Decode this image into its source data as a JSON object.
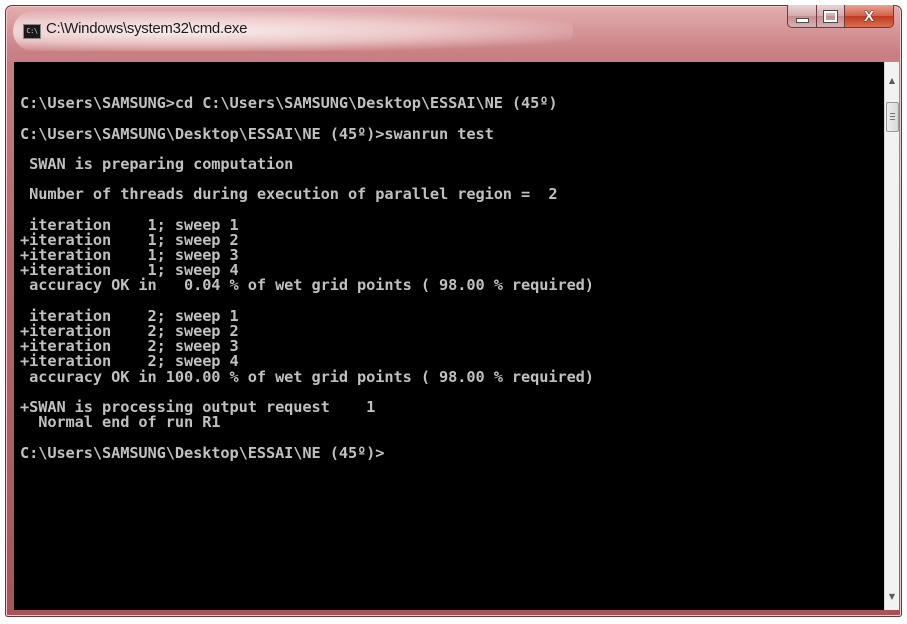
{
  "window": {
    "title": "C:\\Windows\\system32\\cmd.exe",
    "icon": "cmd-icon",
    "icon_text": "C:\\",
    "controls": {
      "minimize_icon": "minimize-icon",
      "maximize_icon": "maximize-icon",
      "close_icon": "close-icon",
      "close_glyph": "X"
    }
  },
  "console": {
    "lines": [
      "",
      "C:\\Users\\SAMSUNG>cd C:\\Users\\SAMSUNG\\Desktop\\ESSAI\\NE (45º)",
      "",
      "C:\\Users\\SAMSUNG\\Desktop\\ESSAI\\NE (45º)>swanrun test",
      "",
      " SWAN is preparing computation",
      "",
      " Number of threads during execution of parallel region =  2",
      "",
      " iteration    1; sweep 1",
      "+iteration    1; sweep 2",
      "+iteration    1; sweep 3",
      "+iteration    1; sweep 4",
      " accuracy OK in   0.04 % of wet grid points ( 98.00 % required)",
      "",
      " iteration    2; sweep 1",
      "+iteration    2; sweep 2",
      "+iteration    2; sweep 3",
      "+iteration    2; sweep 4",
      " accuracy OK in 100.00 % of wet grid points ( 98.00 % required)",
      "",
      "+SWAN is processing output request    1",
      "  Normal end of run R1",
      "",
      "C:\\Users\\SAMSUNG\\Desktop\\ESSAI\\NE (45º)>"
    ]
  },
  "colors": {
    "console_bg": "#000000",
    "console_text": "#c0c0c0",
    "frame": "#b9666b",
    "close_button": "#c13a1f"
  }
}
